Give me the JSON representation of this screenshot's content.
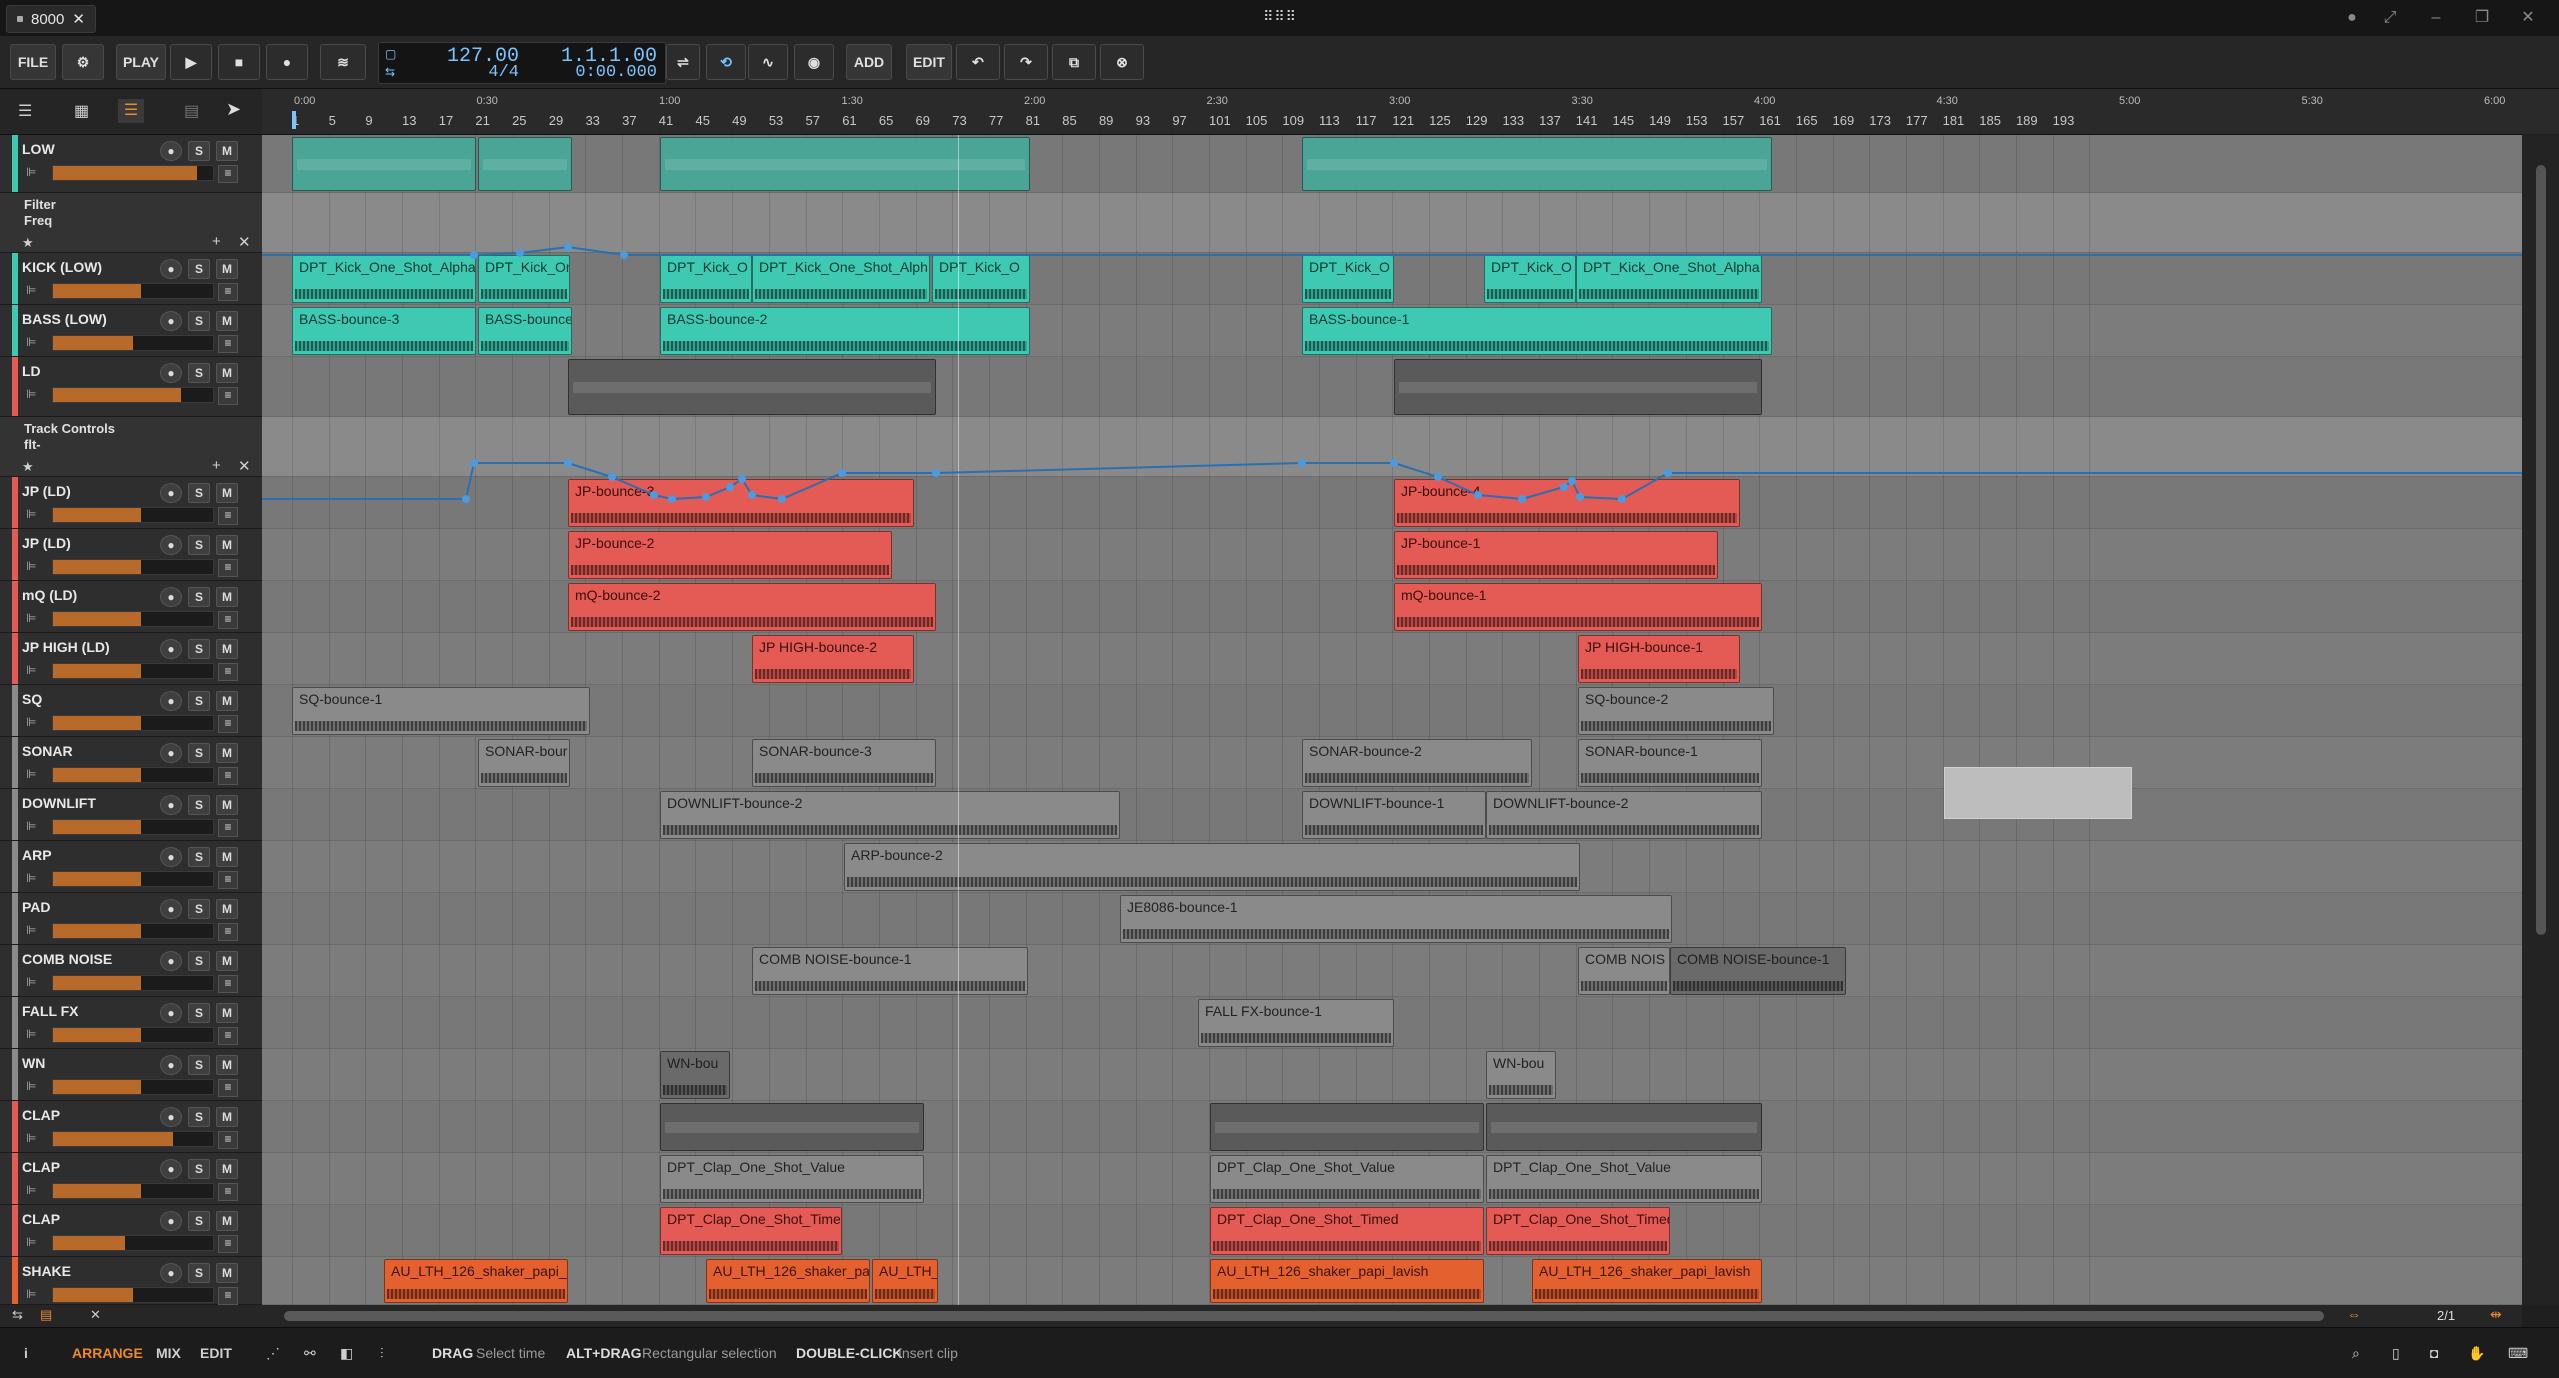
{
  "window": {
    "doc_title": "8000"
  },
  "toolbar": {
    "file_label": "FILE",
    "play_label": "PLAY",
    "add_label": "ADD",
    "edit_label": "EDIT",
    "tempo": "127.00",
    "time_signature": "4/4",
    "position_bars": "1.1.1.00",
    "position_time": "0:00.000"
  },
  "ruler": {
    "bars": [
      "1",
      "5",
      "9",
      "13",
      "17",
      "21",
      "25",
      "29",
      "33",
      "37",
      "41",
      "45",
      "49",
      "53",
      "57",
      "61",
      "65",
      "69",
      "73",
      "77",
      "81",
      "85",
      "89",
      "93",
      "97",
      "101",
      "105",
      "109",
      "113",
      "117",
      "121",
      "125",
      "129",
      "133",
      "137",
      "141",
      "145",
      "149",
      "153",
      "157",
      "161",
      "165",
      "169",
      "173",
      "177",
      "181",
      "185",
      "189",
      "193"
    ],
    "times": [
      "0:00",
      "0:30",
      "1:00",
      "1:30",
      "2:00",
      "2:30",
      "3:00",
      "3:30",
      "4:00",
      "4:30",
      "5:00",
      "5:30",
      "6:00"
    ]
  },
  "tracks": [
    {
      "name": "LOW",
      "color": "#3ec9b2"
    },
    {
      "name": "Filter",
      "sub": "Freq",
      "automation": true
    },
    {
      "name": "KICK (LOW)",
      "color": "#3ec9b2"
    },
    {
      "name": "BASS (LOW)",
      "color": "#3ec9b2"
    },
    {
      "name": "LD",
      "color": "#e45a54"
    },
    {
      "name": "Track Controls",
      "sub": "flt-",
      "automation": true
    },
    {
      "name": "JP (LD)",
      "color": "#e45a54"
    },
    {
      "name": "JP (LD)",
      "color": "#e45a54"
    },
    {
      "name": "mQ (LD)",
      "color": "#e45a54"
    },
    {
      "name": "JP HIGH (LD)",
      "color": "#e45a54"
    },
    {
      "name": "SQ",
      "color": "#8a8a8a"
    },
    {
      "name": "SONAR",
      "color": "#8a8a8a"
    },
    {
      "name": "DOWNLIFT",
      "color": "#8a8a8a"
    },
    {
      "name": "ARP",
      "color": "#8a8a8a"
    },
    {
      "name": "PAD",
      "color": "#8a8a8a"
    },
    {
      "name": "COMB NOISE",
      "color": "#8a8a8a"
    },
    {
      "name": "FALL FX",
      "color": "#8a8a8a"
    },
    {
      "name": "WN",
      "color": "#8a8a8a"
    },
    {
      "name": "CLAP",
      "color": "#e45a54"
    },
    {
      "name": "CLAP",
      "color": "#e45a54"
    },
    {
      "name": "CLAP",
      "color": "#e45a54"
    },
    {
      "name": "SHAKE",
      "color": "#e5602f"
    }
  ],
  "clips": {
    "kick": [
      "DPT_Kick_One_Shot_Alpha",
      "DPT_Kick_Or",
      "DPT_Kick_O",
      "DPT_Kick_One_Shot_Alph.",
      "DPT_Kick_O",
      "DPT_Kick_O",
      "DPT_Kick_O",
      "DPT_Kick_One_Shot_Alpha"
    ],
    "bass": [
      "BASS-bounce-3",
      "BASS-bounce",
      "BASS-bounce-2",
      "BASS-bounce-1"
    ],
    "jp1": [
      "JP-bounce-3",
      "JP-bounce-4"
    ],
    "jp2": [
      "JP-bounce-2",
      "JP-bounce-1"
    ],
    "mq": [
      "mQ-bounce-2",
      "mQ-bounce-1"
    ],
    "jphigh": [
      "JP HIGH-bounce-2",
      "JP HIGH-bounce-1"
    ],
    "sq": [
      "SQ-bounce-1",
      "SQ-bounce-2"
    ],
    "sonar": [
      "SONAR-bour",
      "SONAR-bounce-3",
      "SONAR-bounce-2",
      "SONAR-bounce-1"
    ],
    "downlift": [
      "DOWNLIFT-bounce-2",
      "DOWNLIFT-bounce-1",
      "DOWNLIFT-bounce-2"
    ],
    "arp": [
      "ARP-bounce-2"
    ],
    "pad": [
      "JE8086-bounce-1"
    ],
    "comb": [
      "COMB NOISE-bounce-1",
      "COMB NOIS",
      "COMB NOISE-bounce-1"
    ],
    "fallfx": [
      "FALL FX-bounce-1"
    ],
    "wn": [
      "WN-bou",
      "WN-bou"
    ],
    "clap2": [
      "DPT_Clap_One_Shot_Value",
      "DPT_Clap_One_Shot_Value",
      "DPT_Clap_One_Shot_Value"
    ],
    "clap3": [
      "DPT_Clap_One_Shot_Timed",
      "DPT_Clap_One_Shot_Timed",
      "DPT_Clap_One_Shot_Timed"
    ],
    "shake": [
      "AU_LTH_126_shaker_papi_l",
      "AU_LTH_126_shaker_papi_lavish",
      "AU_LTH_126",
      "AU_LTH_126_shaker_papi_lavish",
      "AU_LTH_126_shaker_papi_lavish"
    ]
  },
  "footer": {
    "zoom": "2/1"
  },
  "status": {
    "tabs": [
      "ARRANGE",
      "MIX",
      "EDIT"
    ],
    "hint1_key": "DRAG",
    "hint1_text": "Select time",
    "hint2_key": "ALT+DRAG",
    "hint2_text": "Rectangular selection",
    "hint3_key": "DOUBLE-CLICK",
    "hint3_text": "Insert clip"
  },
  "colors": {
    "accent": "#e98a2e",
    "teal": "#3ec9b2",
    "red": "#e45a54",
    "orange": "#e5602f",
    "lcd": "#79c3ff"
  }
}
